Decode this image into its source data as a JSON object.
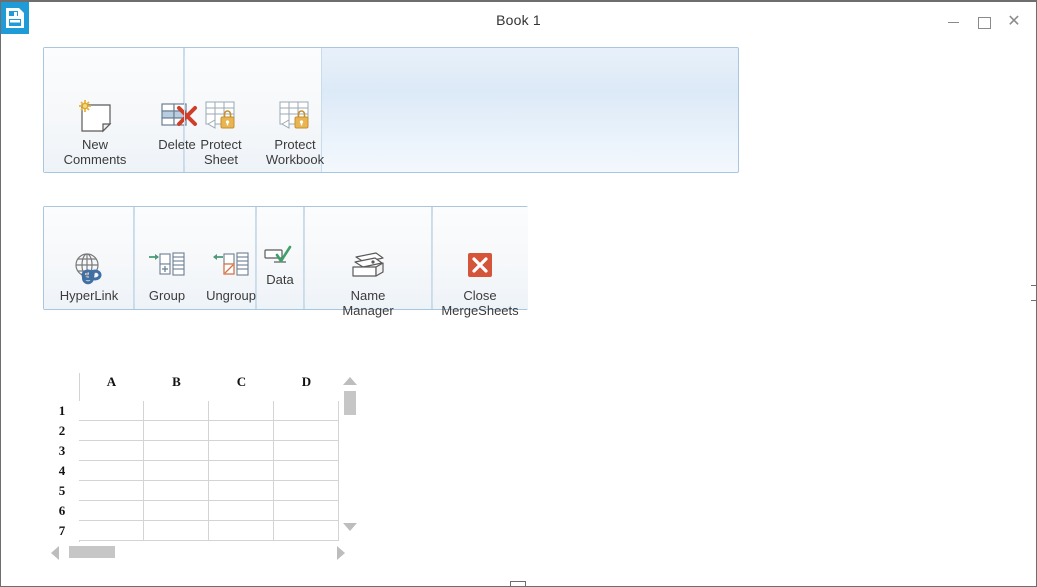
{
  "window": {
    "title": "Book 1",
    "app_icon": "workbook-document-icon",
    "controls": {
      "minimize": "–",
      "maximize": "□",
      "close": "✕"
    }
  },
  "ribbon": {
    "panel_comments": {
      "groups": [
        {
          "name": "comments-group",
          "buttons": [
            {
              "id": "new-comments",
              "label_line1": "New",
              "label_line2": "Comments",
              "icon": "new-comment-note-icon"
            },
            {
              "id": "delete",
              "label_line1": "Delete",
              "label_line2": "",
              "icon": "delete-cells-red-x-icon"
            }
          ]
        },
        {
          "name": "protect-group",
          "buttons": [
            {
              "id": "protect-sheet",
              "label_line1": "Protect",
              "label_line2": "Sheet",
              "icon": "protect-sheet-lock-icon"
            },
            {
              "id": "protect-workbook",
              "label_line1": "Protect",
              "label_line2": "Workbook",
              "icon": "protect-workbook-lock-icon"
            }
          ]
        }
      ]
    },
    "panel_tools": {
      "buttons": [
        {
          "id": "hyperlink",
          "label_line1": "HyperLink",
          "label_line2": "",
          "icon": "globe-link-icon"
        },
        {
          "id": "group",
          "label_line1": "Group",
          "label_line2": "",
          "icon": "group-rows-icon"
        },
        {
          "id": "ungroup",
          "label_line1": "Ungroup",
          "label_line2": "",
          "icon": "ungroup-rows-icon"
        },
        {
          "id": "data",
          "label_line1": "Data",
          "label_line2": "",
          "icon": "data-validation-check-icon"
        },
        {
          "id": "name-manager",
          "label_line1": "Name",
          "label_line2": "Manager",
          "icon": "name-manager-cards-icon"
        },
        {
          "id": "close-mergesheets",
          "label_line1": "Close",
          "label_line2": "MergeSheets",
          "icon": "close-red-x-icon"
        }
      ]
    }
  },
  "sheet": {
    "columns": [
      "A",
      "B",
      "C",
      "D"
    ],
    "rows": [
      "1",
      "2",
      "3",
      "4",
      "5",
      "6",
      "7"
    ],
    "cells": [
      [
        "",
        "",
        "",
        ""
      ],
      [
        "",
        "",
        "",
        ""
      ],
      [
        "",
        "",
        "",
        ""
      ],
      [
        "",
        "",
        "",
        ""
      ],
      [
        "",
        "",
        "",
        ""
      ],
      [
        "",
        "",
        "",
        ""
      ],
      [
        "",
        "",
        "",
        ""
      ]
    ],
    "vertical_scrollbar": {
      "up": "scroll-up-arrow",
      "down": "scroll-down-arrow",
      "thumb": "vertical-scroll-thumb"
    },
    "horizontal_scrollbar": {
      "left": "scroll-left-arrow",
      "right": "scroll-right-arrow",
      "thumb": "horizontal-scroll-thumb"
    }
  },
  "colors": {
    "accent_blue": "#1f9bd7",
    "panel_blue": "#dce9f7",
    "panel_border": "#a8c6e0",
    "close_red": "#d5553a",
    "lock_gold": "#e8b552",
    "group_green": "#4d9a7a",
    "link_blue": "#3f6fa3"
  }
}
